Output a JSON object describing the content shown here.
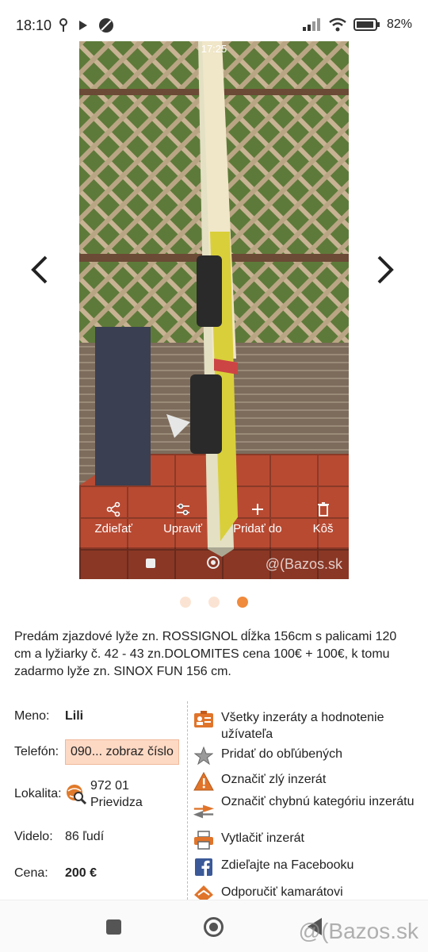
{
  "status_bar": {
    "time": "18:10",
    "battery": "82%"
  },
  "photo": {
    "overlay_time": "17:25",
    "actions": [
      {
        "label": "Zdieľať",
        "icon": "share-icon"
      },
      {
        "label": "Upraviť",
        "icon": "tune-icon"
      },
      {
        "label": "Pridať do",
        "icon": "plus-icon"
      },
      {
        "label": "Kôš",
        "icon": "trash-icon"
      }
    ],
    "watermark": "@(Bazos.sk"
  },
  "gallery": {
    "page_count": 3,
    "active_index": 2
  },
  "description": "Predám zjazdové lyže zn. ROSSIGNOL dĺžka 156cm s palicami 120 cm a lyžiarky č. 42 - 43 zn.DOLOMITES cena 100€ + 100€, k tomu zadarmo lyže zn. SINOX FUN 156 cm.",
  "info": {
    "name_label": "Meno:",
    "name": "Lili",
    "phone_label": "Telefón:",
    "phone_button": "090... zobraz číslo",
    "location_label": "Lokalita:",
    "location_line1": "972 01",
    "location_line2": "Prievidza",
    "views_label": "Videlo:",
    "views": "86 ľudí",
    "price_label": "Cena:",
    "price": "200 €"
  },
  "actions": [
    {
      "label": "Všetky inzeráty a hodnotenie užívateľa",
      "icon": "user-card-icon"
    },
    {
      "label": "Pridať do obľúbených",
      "icon": "star-icon"
    },
    {
      "label": "Označiť zlý inzerát",
      "icon": "warning-icon"
    },
    {
      "label": "Označiť chybnú kategóriu inzerátu",
      "icon": "swap-arrows-icon"
    },
    {
      "label": "Vytlačiť inzerát",
      "icon": "printer-icon"
    },
    {
      "label": "Zdieľajte na Facebooku",
      "icon": "facebook-icon"
    },
    {
      "label": "Odporučiť kamarátovi",
      "icon": "recommend-icon"
    }
  ],
  "watermark": "@(Bazos.sk",
  "colors": {
    "accent": "#f08a3c",
    "phone_bg": "#fdd9c4"
  }
}
